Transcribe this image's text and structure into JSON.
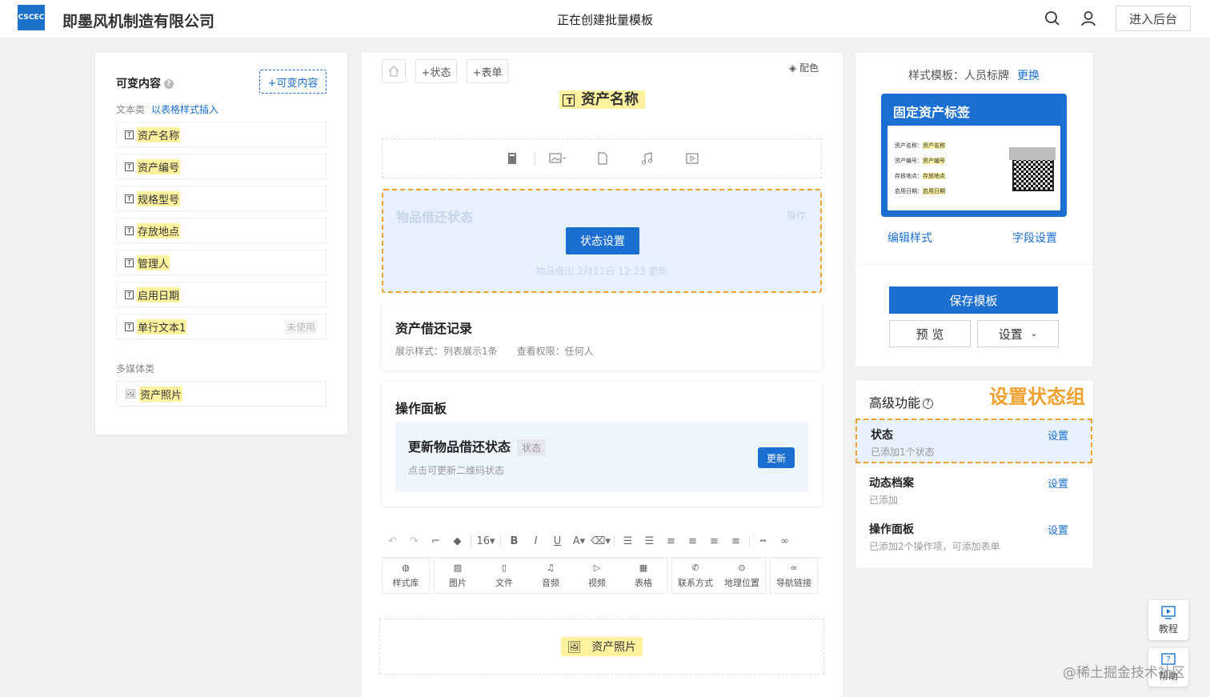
{
  "header": {
    "logo_text": "CSCEC",
    "company": "即墨风机制造有限公司",
    "title": "正在创建批量模板",
    "admin_button": "进入后台"
  },
  "left_panel": {
    "title": "可变内容",
    "help": "?",
    "add_button": "+可变内容",
    "text_category": "文本类",
    "table_insert": "以表格样式插入",
    "text_items": [
      "资产名称",
      "资产编号",
      "规格型号",
      "存放地点",
      "管理人",
      "启用日期",
      "单行文本1"
    ],
    "unused_label": "未使用",
    "media_category": "多媒体类",
    "media_items": [
      "资产照片"
    ]
  },
  "editor": {
    "status_btn": "+状态",
    "form_btn": "+表单",
    "color_btn": "配色",
    "asset_title": "资产名称",
    "status_box": {
      "title": "物品借还状态",
      "op": "操作",
      "button": "状态设置",
      "footer": "物品借出 2月12日 12:23 更新"
    },
    "record_card": {
      "title": "资产借还记录",
      "sub": "展示样式：列表展示1条　　查看权限：任何人"
    },
    "op_panel": {
      "title": "操作面板",
      "item_title": "更新物品借还状态",
      "tag": "状态",
      "item_sub": "点击可更新二维码状态",
      "button": "更新"
    },
    "toolbar": {
      "font_size": "16"
    },
    "insert": [
      "样式库",
      "图片",
      "文件",
      "音频",
      "视频",
      "表格",
      "联系方式",
      "地理位置",
      "导航链接"
    ],
    "photo_placeholder": "资产照片"
  },
  "right_panel": {
    "style_label": "样式模板：人员标牌",
    "change": "更换",
    "badge": {
      "title": "固定资产标签",
      "fields": [
        {
          "label": "资产名称：",
          "value": "资产名称"
        },
        {
          "label": "资产编号：",
          "value": "资产编号"
        },
        {
          "label": "存放地点：",
          "value": "存放地点"
        },
        {
          "label": "启用日期：",
          "value": "启用日期"
        }
      ]
    },
    "edit_style": "编辑样式",
    "field_settings": "字段设置",
    "save": "保存模板",
    "preview": "预 览",
    "settings": "设置"
  },
  "advanced": {
    "title": "高级功能",
    "callout": "设置状态组",
    "items": [
      {
        "title": "状态",
        "sub": "已添加1个状态",
        "action": "设置"
      },
      {
        "title": "动态档案",
        "sub": "已添加",
        "action": "设置"
      },
      {
        "title": "操作面板",
        "sub": "已添加2个操作项，可添加表单",
        "action": "设置"
      }
    ]
  },
  "floating": {
    "tutorial": "教程",
    "help": "帮助"
  },
  "watermark": "@稀土掘金技术社区",
  "colors": {
    "accent": "#1a6fd0",
    "highlight": "#f0a030",
    "var_bg": "#fff3a0"
  }
}
